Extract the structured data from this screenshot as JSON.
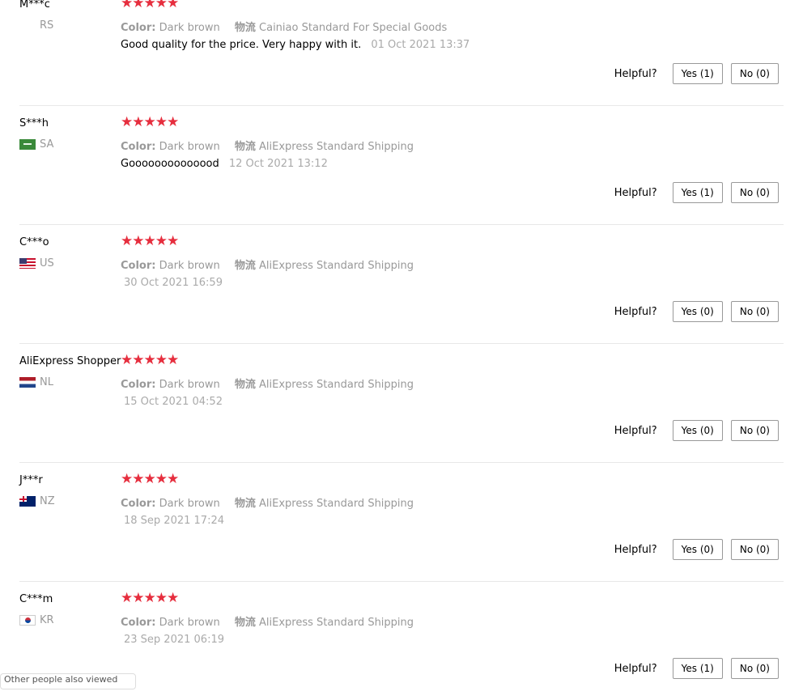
{
  "helpful_label": "Helpful?",
  "reviews": [
    {
      "user": "M***c",
      "country": "RS",
      "stars": "★★★★★",
      "color_label": "Color:",
      "color_value": "Dark brown",
      "shipping_label": "物流",
      "shipping_value": "Cainiao Standard For Special Goods",
      "text": "Good quality for the price. Very happy with it.",
      "date": "01 Oct 2021 13:37",
      "yes": "Yes (1)",
      "no": "No (0)"
    },
    {
      "user": "S***h",
      "country": "SA",
      "stars": "★★★★★",
      "color_label": "Color:",
      "color_value": "Dark brown",
      "shipping_label": "物流",
      "shipping_value": "AliExpress Standard Shipping",
      "text": "Goooooooooooood",
      "date": "12 Oct 2021 13:12",
      "yes": "Yes (1)",
      "no": "No (0)"
    },
    {
      "user": "C***o",
      "country": "US",
      "stars": "★★★★★",
      "color_label": "Color:",
      "color_value": "Dark brown",
      "shipping_label": "物流",
      "shipping_value": "AliExpress Standard Shipping",
      "text": "",
      "date": "30 Oct 2021 16:59",
      "yes": "Yes (0)",
      "no": "No (0)"
    },
    {
      "user": "AliExpress Shopper",
      "country": "NL",
      "stars": "★★★★★",
      "color_label": "Color:",
      "color_value": "Dark brown",
      "shipping_label": "物流",
      "shipping_value": "AliExpress Standard Shipping",
      "text": "",
      "date": "15 Oct 2021 04:52",
      "yes": "Yes (0)",
      "no": "No (0)"
    },
    {
      "user": "J***r",
      "country": "NZ",
      "stars": "★★★★★",
      "color_label": "Color:",
      "color_value": "Dark brown",
      "shipping_label": "物流",
      "shipping_value": "AliExpress Standard Shipping",
      "text": "",
      "date": "18 Sep 2021 17:24",
      "yes": "Yes (0)",
      "no": "No (0)"
    },
    {
      "user": "C***m",
      "country": "KR",
      "stars": "★★★★★",
      "color_label": "Color:",
      "color_value": "Dark brown",
      "shipping_label": "物流",
      "shipping_value": "AliExpress Standard Shipping",
      "text": "",
      "date": "23 Sep 2021 06:19",
      "yes": "Yes (1)",
      "no": "No (0)"
    }
  ],
  "footer_fragment": "Other people also viewed",
  "colors": {
    "star": "#e62e3e",
    "muted": "#999999",
    "divider": "#e8e8e8",
    "button_border": "#999999"
  }
}
